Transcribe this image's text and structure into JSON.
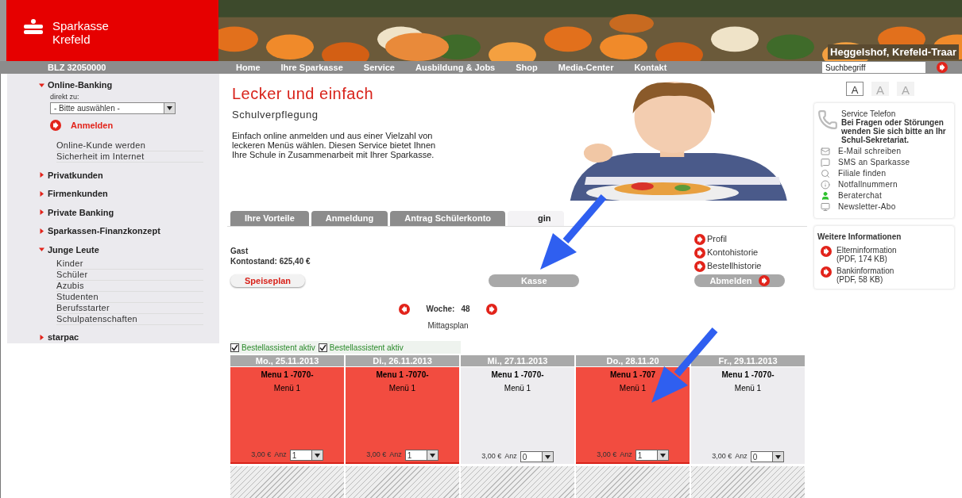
{
  "header": {
    "brand": [
      "Sparkasse",
      "Krefeld"
    ],
    "banner_caption": "Heggelshof, Krefeld-Traar",
    "blz": "BLZ 32050000",
    "nav": [
      "Home",
      "Ihre Sparkasse",
      "Service",
      "Ausbildung & Jobs",
      "Shop",
      "Media-Center",
      "Kontakt"
    ],
    "search": {
      "placeholder": "Suchbegriff"
    }
  },
  "sidebar": {
    "online_banking": {
      "title": "Online-Banking",
      "expanded": true,
      "label": "direkt zu:",
      "select": "- Bitte auswählen -",
      "login": "Anmelden",
      "links": [
        "Online-Kunde werden",
        "Sicherheit im Internet"
      ]
    },
    "items": [
      {
        "label": "Privatkunden",
        "expanded": false
      },
      {
        "label": "Firmenkunden",
        "expanded": false
      },
      {
        "label": "Private Banking",
        "expanded": false
      },
      {
        "label": "Sparkassen-Finanzkonzept",
        "expanded": false
      },
      {
        "label": "Junge Leute",
        "expanded": true,
        "children": [
          {
            "label": "Kinder"
          },
          {
            "label": "Schüler"
          },
          {
            "label": "Azubis"
          },
          {
            "label": "Studenten"
          },
          {
            "label": "Berufsstarter"
          },
          {
            "label": "Schulpatenschaften"
          }
        ]
      },
      {
        "label": "starpac",
        "expanded": false
      }
    ]
  },
  "hero": {
    "title": "Lecker und einfach",
    "subtitle": "Schulverpflegung",
    "text": "Einfach online anmelden und aus einer Vielzahl von leckeren Menüs wählen. Diesen Service bietet Ihnen Ihre Schule in Zusammenarbeit mit Ihrer Sparkasse."
  },
  "tabs": [
    {
      "label": "Ihre Vorteile",
      "selected": false
    },
    {
      "label": "Anmeldung",
      "selected": false
    },
    {
      "label": "Antrag Schülerkonto",
      "selected": false
    },
    {
      "label": "gin",
      "selected": true
    }
  ],
  "account": {
    "user": "Gast",
    "balance": "Kontostand: 625,40 €",
    "links": [
      "Profil",
      "Kontohistorie",
      "Bestellhistorie"
    ],
    "menu_button": "Speiseplan",
    "checkout_button": "Kasse",
    "logout_button": "Abmelden"
  },
  "week": {
    "label": "Woche:",
    "number": "48",
    "caption": "Mittagsplan"
  },
  "assistants": [
    {
      "label": "Bestellassistent aktiv",
      "checked": true
    },
    {
      "label": "Bestellassistent aktiv",
      "checked": true
    }
  ],
  "days": [
    {
      "date": "Mo., 25.11.2013",
      "menu": "Menu 1 -7070-",
      "desc": "Menü 1",
      "price": "3,00 €",
      "qty_label": "Anz",
      "qty": "1",
      "selected": true
    },
    {
      "date": "Di., 26.11.2013",
      "menu": "Menu 1 -7070-",
      "desc": "Menü 1",
      "price": "3,00 €",
      "qty_label": "Anz",
      "qty": "1",
      "selected": true
    },
    {
      "date": "Mi., 27.11.2013",
      "menu": "Menu 1 -7070-",
      "desc": "Menü 1",
      "price": "3,00 €",
      "qty_label": "Anz",
      "qty": "0",
      "selected": false
    },
    {
      "date": "Do., 28.11.20",
      "menu": "Menu 1 -707",
      "desc": "Menü 1",
      "price": "3,00 €",
      "qty_label": "Anz",
      "qty": "1",
      "selected": true
    },
    {
      "date": "Fr., 29.11.2013",
      "menu": "Menu 1 -7070-",
      "desc": "Menü 1",
      "price": "3,00 €",
      "qty_label": "Anz",
      "qty": "0",
      "selected": false
    }
  ],
  "font_sizes": [
    {
      "label": "A",
      "selected": true
    },
    {
      "label": "A",
      "selected": false
    },
    {
      "label": "A",
      "selected": false
    }
  ],
  "service": {
    "title": "Service Telefon",
    "notice": "Bei Fragen oder Störungen wenden Sie sich bitte an Ihr Schul-Sekretariat.",
    "links": [
      {
        "kind": "mail",
        "label": "E-Mail schreiben"
      },
      {
        "kind": "sms",
        "label": "SMS an Sparkasse"
      },
      {
        "kind": "search",
        "label": "Filiale finden"
      },
      {
        "kind": "info",
        "label": "Notfallnummern"
      },
      {
        "kind": "chat",
        "label": "Beraterchat"
      },
      {
        "kind": "newsletter",
        "label": "Newsletter-Abo"
      }
    ]
  },
  "more_info": {
    "title": "Weitere Informationen",
    "links": [
      {
        "label": "Elterninformation",
        "detail": "(PDF, 174 KB)"
      },
      {
        "label": "Bankinformation",
        "detail": "(PDF, 58 KB)"
      }
    ]
  }
}
